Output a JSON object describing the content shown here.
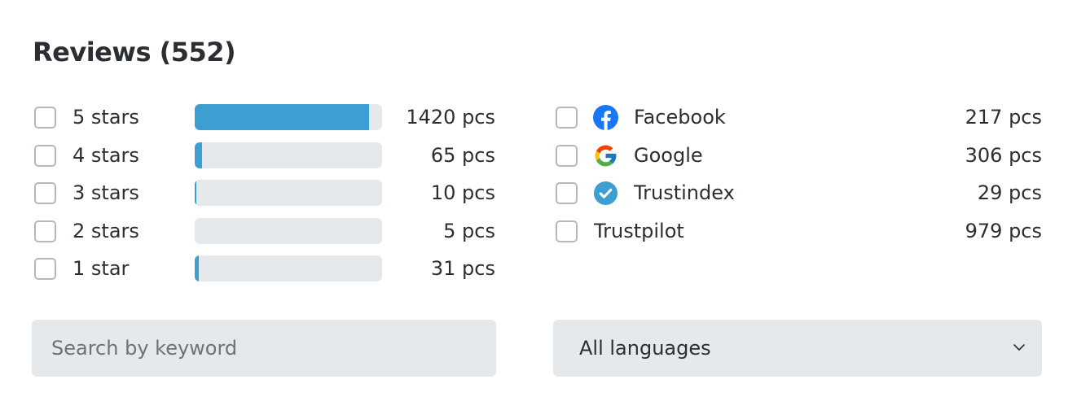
{
  "header": {
    "title": "Reviews (552)"
  },
  "rating_filters": [
    {
      "label": "5 stars",
      "count": "1420 pcs",
      "fill_fraction": 0.93
    },
    {
      "label": "4 stars",
      "count": "65 pcs",
      "fill_fraction": 0.04
    },
    {
      "label": "3 stars",
      "count": "10 pcs",
      "fill_fraction": 0.01
    },
    {
      "label": "2 stars",
      "count": "5 pcs",
      "fill_fraction": 0.0
    },
    {
      "label": "1 star",
      "count": "31 pcs",
      "fill_fraction": 0.02
    }
  ],
  "source_filters": [
    {
      "label": "Facebook",
      "count": "217 pcs",
      "icon": "facebook-icon"
    },
    {
      "label": "Google",
      "count": "306 pcs",
      "icon": "google-icon"
    },
    {
      "label": "Trustindex",
      "count": "29 pcs",
      "icon": "trustindex-icon"
    },
    {
      "label": "Trustpilot",
      "count": "979 pcs",
      "icon": ""
    }
  ],
  "search": {
    "placeholder": "Search by keyword",
    "value": ""
  },
  "language_select": {
    "value": "All languages"
  },
  "colors": {
    "bar_fill": "#3d9fd1",
    "bar_track": "#e6e9ec",
    "facebook": "#1877f2",
    "trustindex": "#3d9fd1"
  }
}
